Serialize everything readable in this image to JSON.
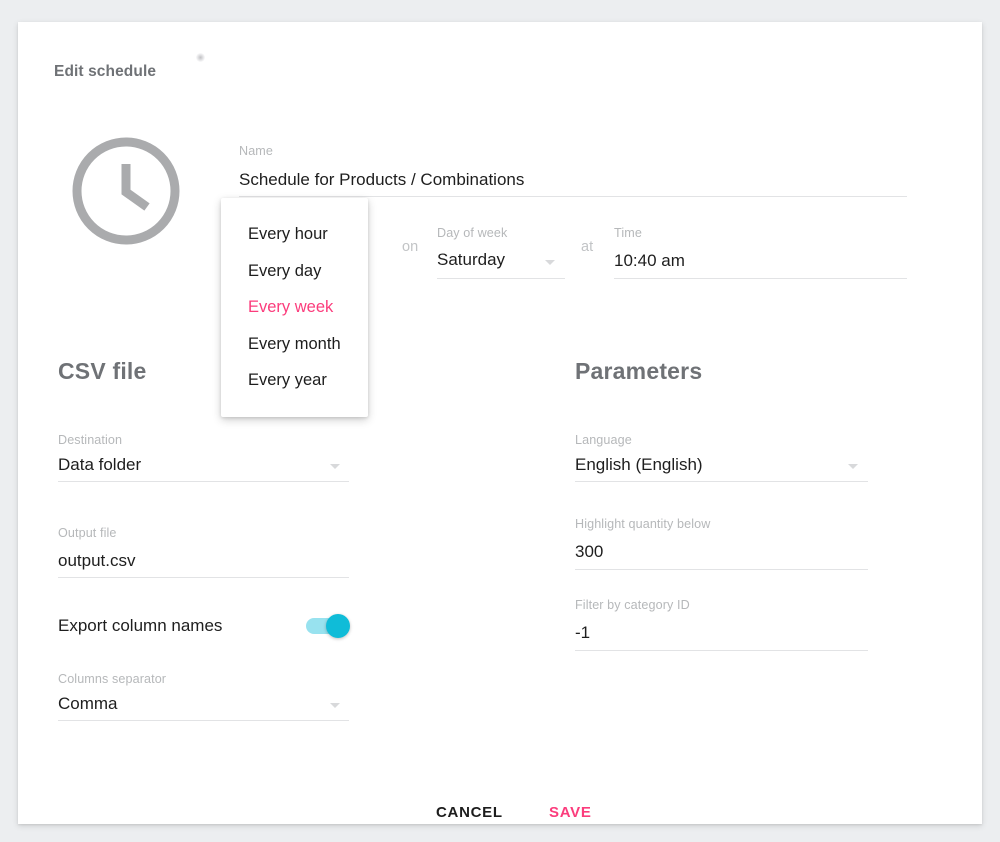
{
  "dialog": {
    "title": "Edit schedule",
    "clock_icon": "clock-icon"
  },
  "name_field": {
    "label": "Name",
    "value": "Schedule for Products / Combinations",
    "placeholder": "Name"
  },
  "frequency": {
    "conjunction_on": "on",
    "conjunction_at": "at",
    "selected": "Every week",
    "options": [
      "Every hour",
      "Every day",
      "Every week",
      "Every month",
      "Every year"
    ]
  },
  "day_of_week": {
    "label": "Day of week",
    "value": "Saturday",
    "caret_icon": "chevron-down-icon"
  },
  "time": {
    "label": "Time",
    "value": "10:40 am",
    "placeholder": "Time"
  },
  "csv": {
    "section_title": "CSV file",
    "destination": {
      "label": "Destination",
      "value": "Data folder",
      "caret_icon": "chevron-down-icon"
    },
    "output_file": {
      "label": "Output file",
      "value": "output.csv",
      "placeholder": "Output file"
    },
    "export_column_names": {
      "label": "Export column names",
      "enabled": true,
      "toggle_icon": "toggle-on-icon"
    },
    "columns_separator": {
      "label": "Columns separator",
      "value": "Comma",
      "caret_icon": "chevron-down-icon"
    }
  },
  "parameters": {
    "section_title": "Parameters",
    "language": {
      "label": "Language",
      "value": "English (English)",
      "caret_icon": "chevron-down-icon"
    },
    "highlight_quantity_below": {
      "label": "Highlight quantity below",
      "value": "300",
      "placeholder": "Highlight quantity below"
    },
    "filter_by_category_id": {
      "label": "Filter by category ID",
      "value": "-1",
      "placeholder": "Filter by category ID"
    }
  },
  "footer": {
    "cancel_label": "CANCEL",
    "save_label": "SAVE"
  },
  "colors": {
    "accent_pink": "#fb3c7c",
    "toggle_on": "#0fbcd8",
    "toggle_track": "#98e2ef",
    "label_gray": "#b6b8ba",
    "heading_gray": "#6f7276",
    "underline": "#e2e3e5",
    "page_background": "#eceef0",
    "card_background": "#ffffff"
  }
}
